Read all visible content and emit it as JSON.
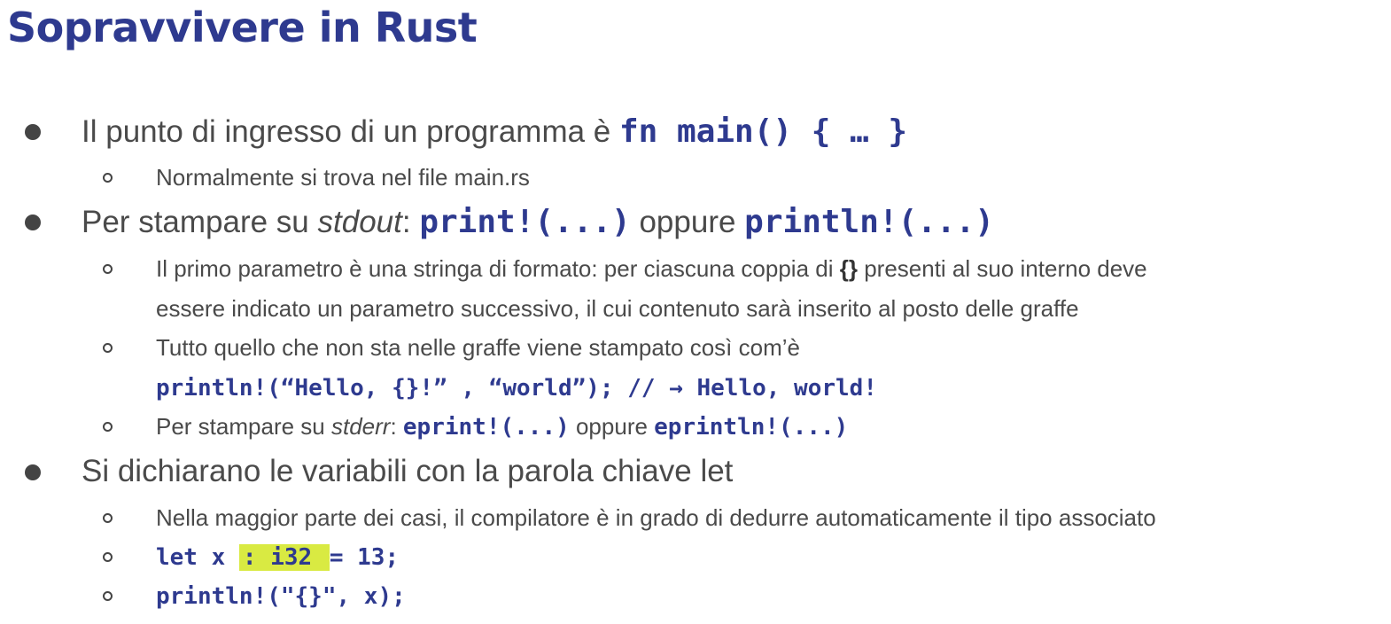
{
  "slide": {
    "title": "Sopravvivere in Rust",
    "entry": {
      "text": "Il punto di ingresso di un programma è ",
      "code": "fn main() { … }",
      "sub1": "Normalmente si trova nel file main.rs"
    },
    "print": {
      "prefix": "Per stampare su ",
      "stdout": "stdout",
      "colon": ": ",
      "code1": "print!(...)",
      "or": " oppure ",
      "code2": "println!(...)",
      "sub1_part1": "Il primo parametro è una stringa di formato: per ciascuna coppia di ",
      "sub1_braces": "{}",
      "sub1_part2": " presenti al suo interno deve",
      "sub1_line2": "essere indicato un parametro successivo, il cui contenuto sarà inserito al posto delle graffe",
      "sub2_line1": "Tutto quello che non sta nelle graffe viene stampato così com’è",
      "sub2_code": "println!(“Hello, {}!” , “world”); // → Hello, world!",
      "sub3_prefix": "Per stampare su ",
      "stderr": "stderr",
      "sub3_colon": ": ",
      "sub3_code1": "eprint!(...)",
      "sub3_or": " oppure ",
      "sub3_code2": "eprintln!(...)"
    },
    "let": {
      "text": "Si dichiarano le variabili con la parola chiave let",
      "sub1": "Nella maggior parte dei casi, il compilatore è in grado di dedurre automaticamente il tipo associato",
      "code_a": "let x ",
      "code_hl": ": i32 ",
      "code_b": "= 13;",
      "code2": "println!(\"{}\", x);"
    }
  }
}
